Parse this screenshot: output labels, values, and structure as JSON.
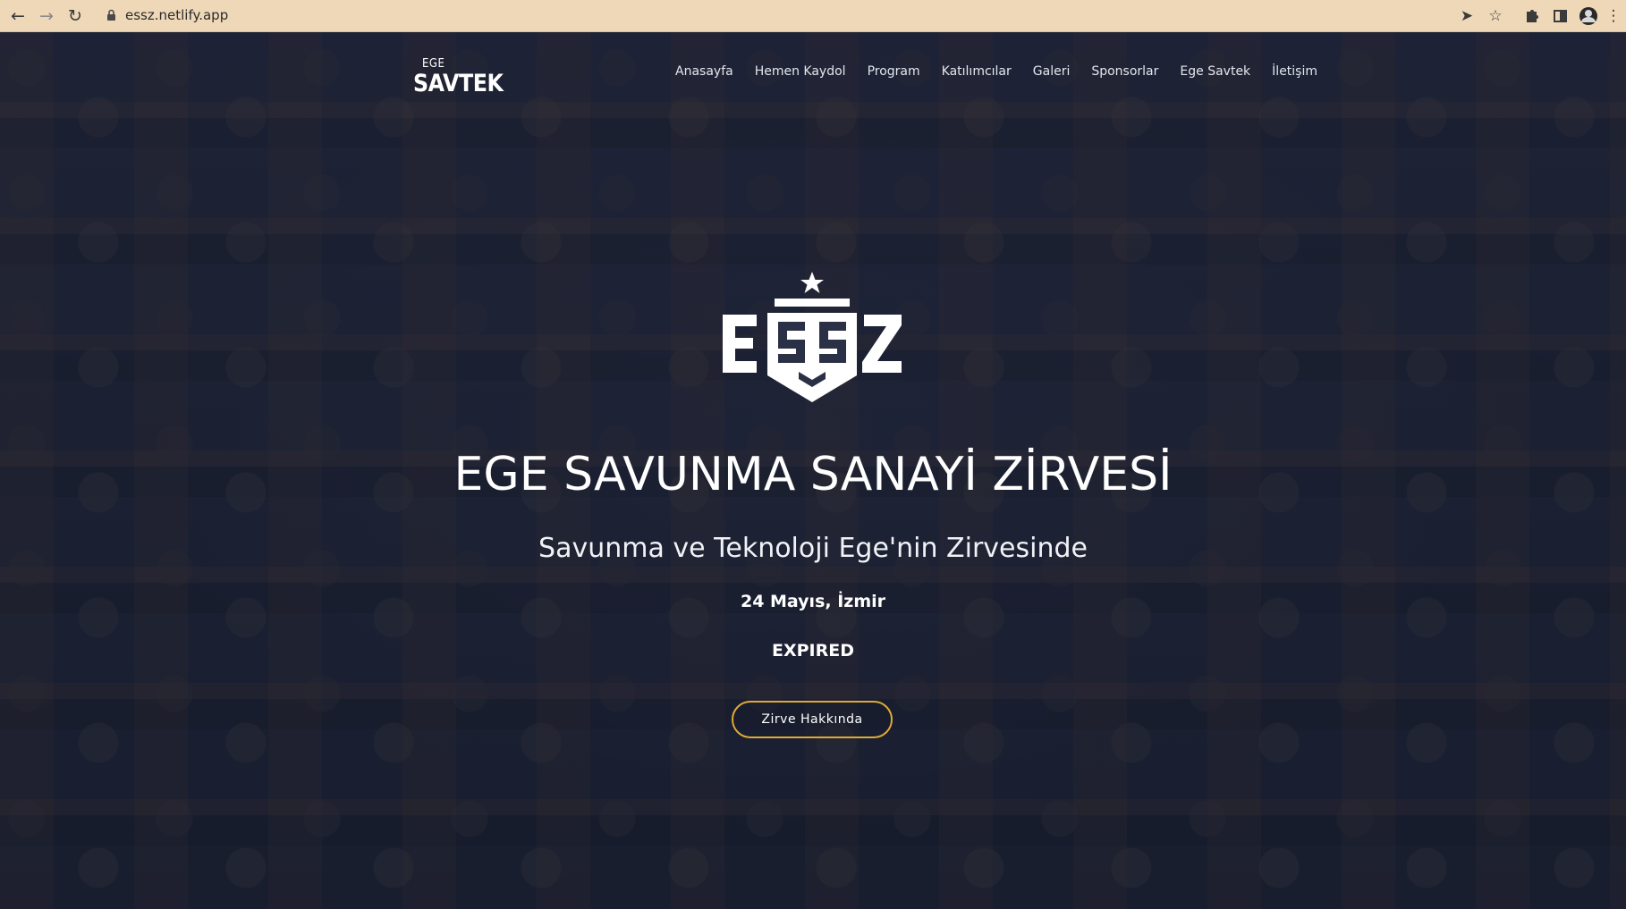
{
  "browser": {
    "url": "essz.netlify.app",
    "icons": {
      "back": "back-arrow-icon",
      "forward": "forward-arrow-icon",
      "reload": "reload-icon",
      "lock": "lock-icon",
      "send": "send-tab-icon",
      "bookmark": "star-icon",
      "extensions": "puzzle-icon",
      "sidepanel": "side-panel-icon",
      "profile": "avatar",
      "menu": "kebab-menu-icon"
    },
    "chrome_color": "#efd8b8"
  },
  "site": {
    "logo_small": "EGE",
    "logo_main": "SAVTEK",
    "nav": [
      {
        "label": "Anasayfa"
      },
      {
        "label": "Hemen Kaydol"
      },
      {
        "label": "Program"
      },
      {
        "label": "Katılımcılar"
      },
      {
        "label": "Galeri"
      },
      {
        "label": "Sponsorlar"
      },
      {
        "label": "Ege Savtek"
      },
      {
        "label": "İletişim"
      }
    ]
  },
  "hero": {
    "emblem_text": "ESSZ",
    "title": "EGE SAVUNMA SANAYİ ZİRVESİ",
    "subtitle": "Savunma ve Teknoloji Ege'nin Zirvesinde",
    "date": "24 Mayıs, İzmir",
    "countdown": "EXPIRED",
    "cta_label": "Zirve Hakkında",
    "accent_color": "#e0a935"
  }
}
